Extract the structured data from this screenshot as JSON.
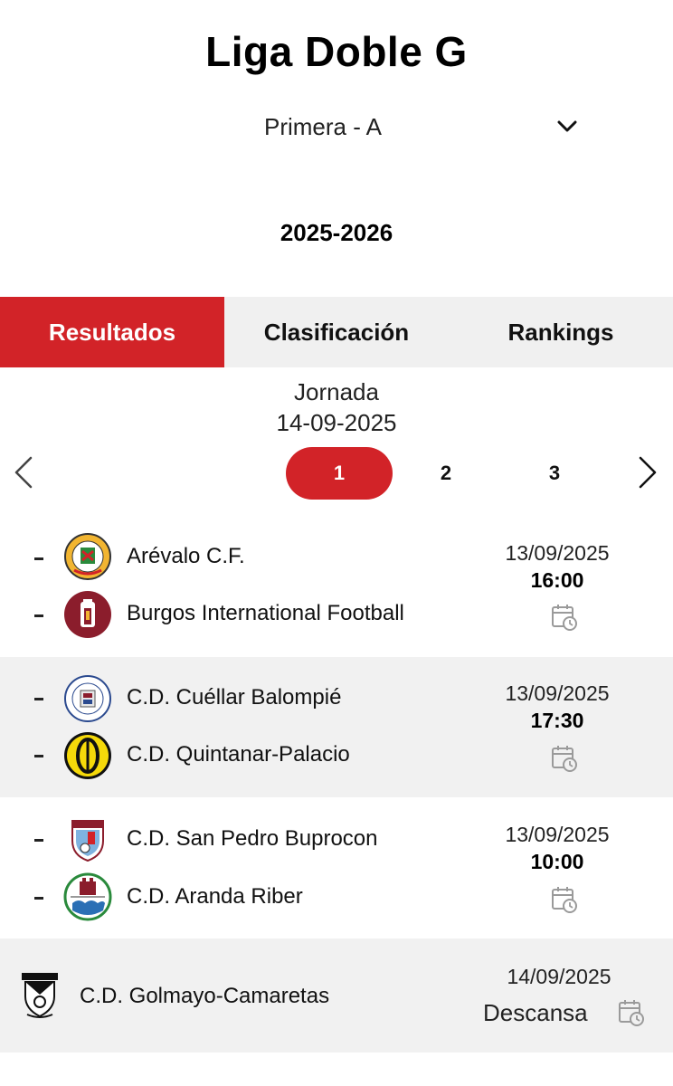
{
  "header": {
    "title": "Liga Doble G",
    "division": "Primera - A",
    "season": "2025-2026"
  },
  "tabs": [
    {
      "label": "Resultados",
      "active": true
    },
    {
      "label": "Clasificación",
      "active": false
    },
    {
      "label": "Rankings",
      "active": false
    }
  ],
  "jornada": {
    "label": "Jornada",
    "date": "14-09-2025",
    "pages": [
      "1",
      "2",
      "3"
    ],
    "active_page": "1"
  },
  "matches": [
    {
      "home": {
        "name": "Arévalo C.F.",
        "score": "-"
      },
      "away": {
        "name": "Burgos International Football",
        "score": "-"
      },
      "date": "13/09/2025",
      "time": "16:00"
    },
    {
      "home": {
        "name": "C.D. Cuéllar Balompié",
        "score": "-"
      },
      "away": {
        "name": "C.D. Quintanar-Palacio",
        "score": "-"
      },
      "date": "13/09/2025",
      "time": "17:30"
    },
    {
      "home": {
        "name": "C.D. San Pedro Buprocon",
        "score": "-"
      },
      "away": {
        "name": "C.D. Aranda Riber",
        "score": "-"
      },
      "date": "13/09/2025",
      "time": "10:00"
    }
  ],
  "rest": {
    "team": "C.D. Golmayo-Camaretas",
    "date": "14/09/2025",
    "status": "Descansa"
  },
  "colors": {
    "accent": "#d22328",
    "tab_bar": "#f0f0f0",
    "row_shade": "#f1f1f1",
    "calendar_icon": "#9a9a9a"
  }
}
